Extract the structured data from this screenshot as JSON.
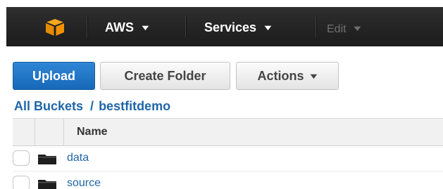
{
  "topbar": {
    "logo_icon": "aws-cube-icon",
    "brand_label": "AWS",
    "services_label": "Services",
    "edit_label": "Edit"
  },
  "toolbar": {
    "upload_label": "Upload",
    "create_folder_label": "Create Folder",
    "actions_label": "Actions"
  },
  "breadcrumb": {
    "root_label": "All Buckets",
    "separator": "/",
    "current_label": "bestfitdemo"
  },
  "table": {
    "columns": [
      "Name"
    ],
    "rows": [
      {
        "name": "data",
        "icon": "folder-icon"
      },
      {
        "name": "source",
        "icon": "folder-icon"
      }
    ]
  },
  "colors": {
    "topbar_bg": "#232323",
    "primary_button": "#1f78c9",
    "link": "#1f66a8",
    "logo_orange": "#f29100"
  }
}
